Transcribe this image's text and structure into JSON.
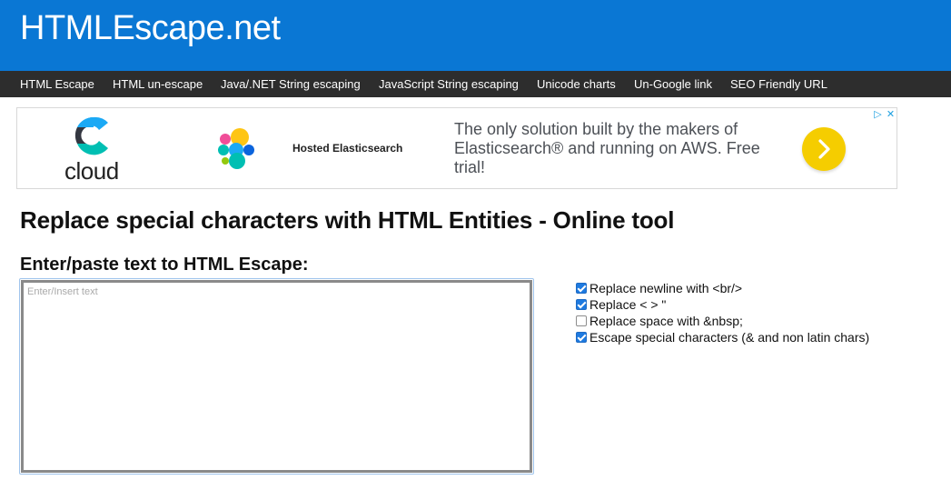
{
  "header": {
    "site_title": "HTMLEscape.net"
  },
  "nav": {
    "items": [
      "HTML Escape",
      "HTML un-escape",
      "Java/.NET String escaping",
      "JavaScript String escaping",
      "Unicode charts",
      "Un-Google link",
      "SEO Friendly URL"
    ]
  },
  "ad": {
    "logo_text": "cloud",
    "hosted_label": "Hosted Elasticsearch",
    "copy": "The only solution built by the makers of Elasticsearch® and running on AWS. Free trial!",
    "go_icon": "chevron-right-icon",
    "choices_icon": "ad-choices-icon",
    "close_icon": "close-icon"
  },
  "main": {
    "title": "Replace special characters with HTML Entities - Online tool",
    "input_label": "Enter/paste text to HTML Escape:",
    "input": {
      "value": "",
      "placeholder": "Enter/Insert text"
    }
  },
  "options": [
    {
      "label": "Replace newline with <br/>",
      "checked": true
    },
    {
      "label": "Replace < > \"",
      "checked": true
    },
    {
      "label": "Replace space with &nbsp;",
      "checked": false
    },
    {
      "label": "Escape special characters (& and non latin chars)",
      "checked": true
    }
  ],
  "colors": {
    "header_bg": "#0a77d4",
    "nav_bg": "#2d2d2d",
    "checkbox_on": "#1e7ae0",
    "ad_button": "#f5cd00"
  }
}
